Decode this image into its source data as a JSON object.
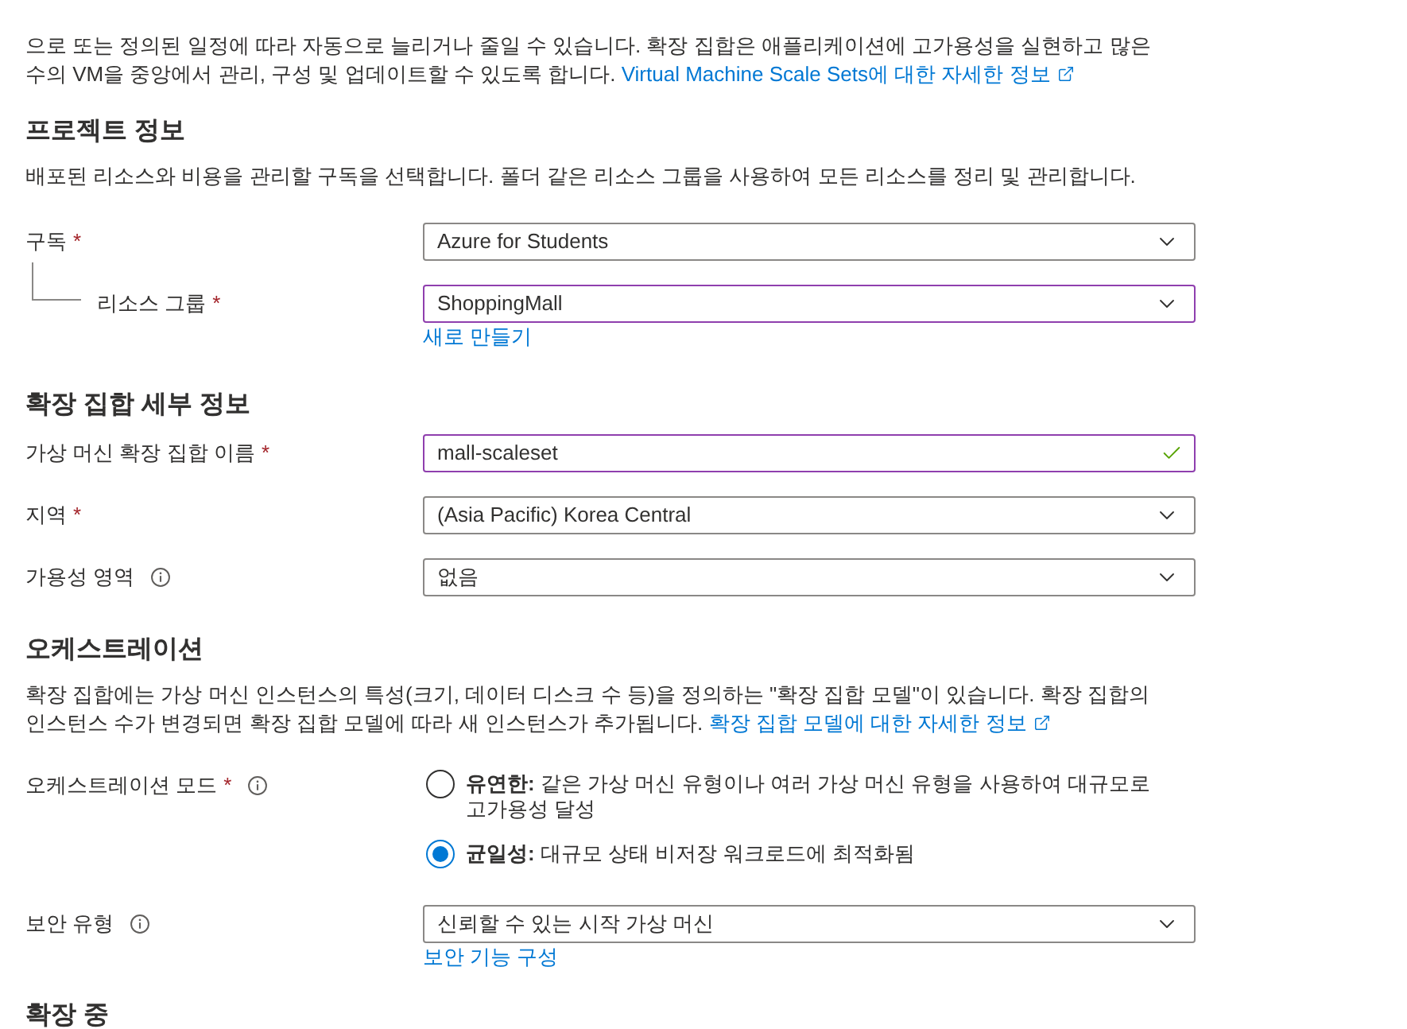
{
  "intro": {
    "text": "으로 또는 정의된 일정에 따라 자동으로 늘리거나 줄일 수 있습니다. 확장 집합은 애플리케이션에 고가용성을 실현하고 많은 수의 VM을 중앙에서 관리, 구성 및 업데이트할 수 있도록 합니다.",
    "link": "Virtual Machine Scale Sets에 대한 자세한 정보"
  },
  "sections": [
    {
      "heading": "프로젝트 정보",
      "description": {
        "text": "배포된 리소스와 비용을 관리할 구독을 선택합니다. 폴더 같은 리소스 그룹을 사용하여 모든 리소스를 정리 및 관리합니다."
      },
      "fields": [
        {
          "kind": "dropdown",
          "label": "구독",
          "required_mark": "*",
          "value": "Azure for Students",
          "modified": false,
          "children": [
            {
              "kind": "dropdown",
              "label": "리소스 그룹",
              "required_mark": "*",
              "value": "ShoppingMall",
              "modified": true,
              "link": "새로 만들기"
            }
          ]
        }
      ]
    },
    {
      "heading": "확장 집합 세부 정보",
      "fields": [
        {
          "kind": "text",
          "label": "가상 머신 확장 집합 이름",
          "required_mark": "*",
          "value": "mall-scaleset",
          "modified": true,
          "valid": true
        },
        {
          "kind": "dropdown",
          "label": "지역",
          "required_mark": "*",
          "value": "(Asia Pacific) Korea Central",
          "modified": false
        },
        {
          "kind": "dropdown",
          "label": "가용성 영역",
          "info": true,
          "value": "없음",
          "modified": false
        }
      ]
    },
    {
      "heading": "오케스트레이션",
      "description": {
        "text": "확장 집합에는 가상 머신 인스턴스의 특성(크기, 데이터 디스크 수 등)을 정의하는 \"확장 집합 모델\"이 있습니다. 확장 집합의 인스턴스 수가 변경되면 확장 집합 모델에 따라 새 인스턴스가 추가됩니다.",
        "link": "확장 집합 모델에 대한 자세한 정보"
      },
      "fields": [
        {
          "kind": "radio",
          "label": "오케스트레이션 모드",
          "required_mark": "*",
          "info": true,
          "options": [
            {
              "text": "**유연한:** 같은 가상 머신 유형이나 여러 가상 머신 유형을 사용하여 대규모로 고가용성 달성",
              "selected": false
            },
            {
              "text": "**균일성:** 대규모 상태 비저장 워크로드에 최적화됨",
              "selected": true
            }
          ]
        },
        {
          "kind": "dropdown",
          "label": "보안 유형",
          "info": true,
          "value": "신뢰할 수 있는 시작 가상 머신",
          "modified": false,
          "link": "보안 기능 구성"
        }
      ]
    },
    {
      "heading": "확장 중"
    }
  ]
}
